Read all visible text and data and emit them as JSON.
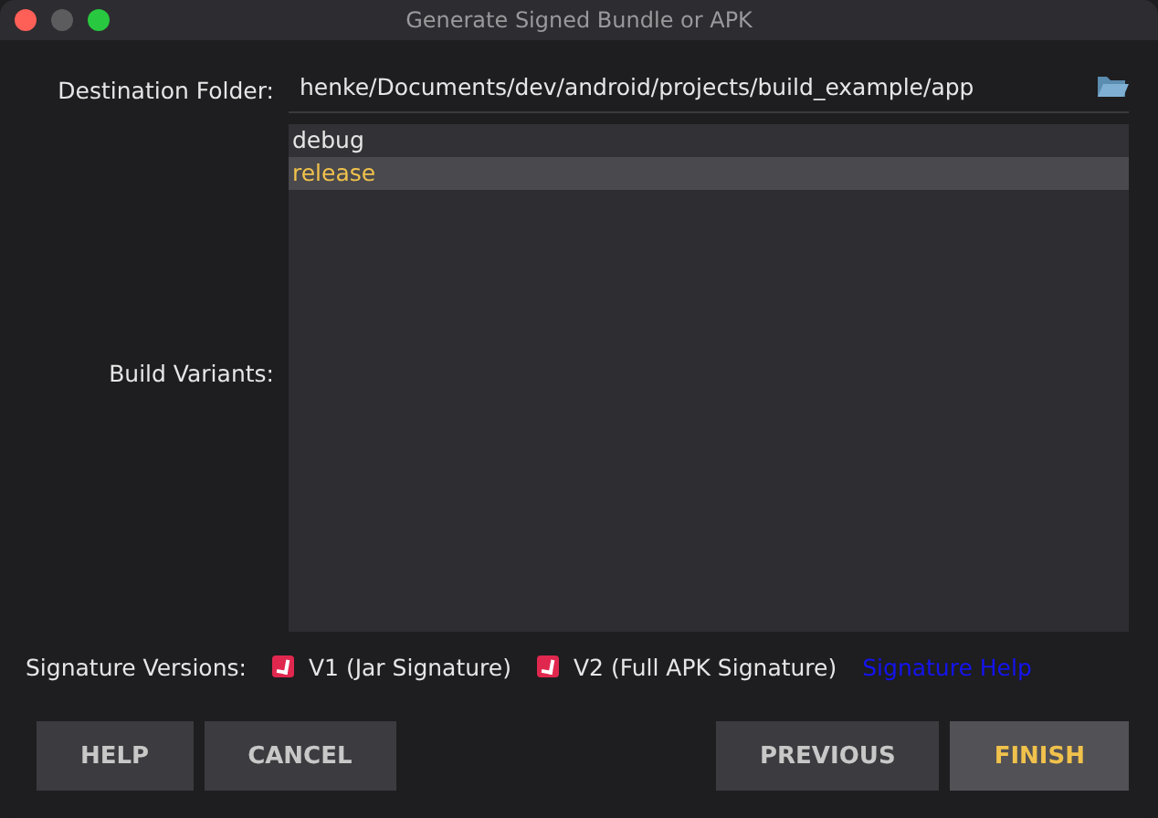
{
  "window": {
    "title": "Generate Signed Bundle or APK"
  },
  "destination": {
    "label": "Destination Folder:",
    "value": "henke/Documents/dev/android/projects/build_example/app"
  },
  "build_variants": {
    "label": "Build Variants:",
    "items": [
      {
        "label": "debug",
        "selected": false
      },
      {
        "label": "release",
        "selected": true
      }
    ]
  },
  "signature_versions": {
    "label": "Signature Versions:",
    "options": [
      {
        "label": "V1 (Jar Signature)",
        "checked": true
      },
      {
        "label": "V2 (Full APK Signature)",
        "checked": true
      }
    ],
    "help_link": "Signature Help"
  },
  "left_buttons": [
    {
      "label": "HELP",
      "default": false
    },
    {
      "label": "CANCEL",
      "default": false
    }
  ],
  "right_buttons": [
    {
      "label": "PREVIOUS",
      "default": false
    },
    {
      "label": "FINISH",
      "default": true
    }
  ]
}
